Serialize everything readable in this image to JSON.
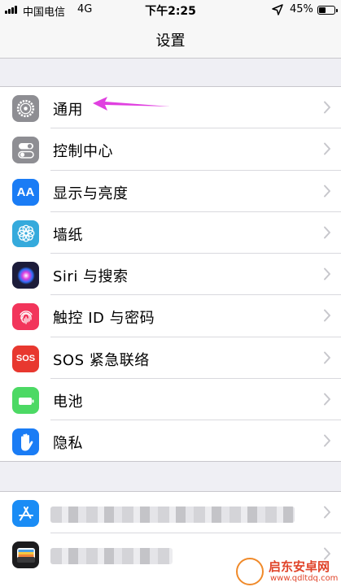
{
  "status_bar": {
    "carrier": "中国电信",
    "network": "4G",
    "time": "下午2:25",
    "battery_percent": "45%",
    "battery_level": 0.45
  },
  "nav": {
    "title": "设置"
  },
  "settings_group": [
    {
      "label": "通用",
      "icon": "gear-icon",
      "color": "#8e8e93"
    },
    {
      "label": "控制中心",
      "icon": "toggles-icon",
      "color": "#8e8e93"
    },
    {
      "label": "显示与亮度",
      "icon": "text-size-icon",
      "color": "#1a7cf5",
      "glyph": "AA"
    },
    {
      "label": "墙纸",
      "icon": "flower-icon",
      "color": "#35aadc"
    },
    {
      "label": "Siri 与搜索",
      "icon": "siri-icon",
      "color": "#1c1c3a"
    },
    {
      "label": "触控 ID 与密码",
      "icon": "fingerprint-icon",
      "color": "#f2355b"
    },
    {
      "label": "SOS 紧急联络",
      "icon": "sos-icon",
      "color": "#e8382f",
      "glyph": "SOS"
    },
    {
      "label": "电池",
      "icon": "battery-icon",
      "color": "#4cd964"
    },
    {
      "label": "隐私",
      "icon": "hand-icon",
      "color": "#1a7cf5"
    }
  ],
  "store_group": [
    {
      "icon": "app-store-icon",
      "color": "#1a8cf5"
    },
    {
      "icon": "wallet-icon",
      "color": "#1c1c1e"
    }
  ],
  "watermark": {
    "title": "启东安卓网",
    "url": "www.qdltdq.com"
  },
  "colors": {
    "annotation_arrow": "#e040e0",
    "chevron": "#c7c7cc"
  }
}
